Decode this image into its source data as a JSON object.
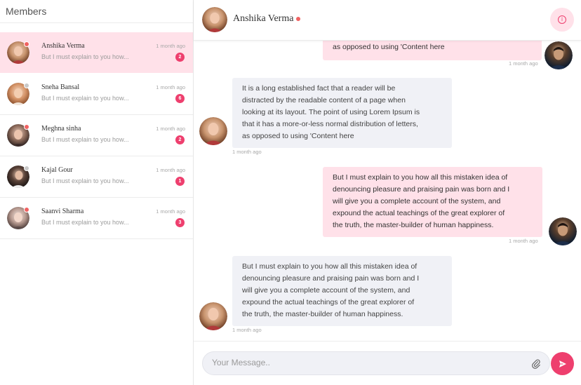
{
  "sidebar": {
    "title": "Members",
    "members": [
      {
        "name": "Anshika Verma",
        "preview": "But I must explain to you how...",
        "time": "1 month ago",
        "unread": "2",
        "online": true
      },
      {
        "name": "Sneha Bansal",
        "preview": "But I must explain to you how...",
        "time": "1 month ago",
        "unread": "6",
        "online": false
      },
      {
        "name": "Meghna sinha",
        "preview": "But I must explain to you how...",
        "time": "1 month ago",
        "unread": "2",
        "online": true
      },
      {
        "name": "Kajal Gour",
        "preview": "But I must explain to you how...",
        "time": "1 month ago",
        "unread": "1",
        "online": false
      },
      {
        "name": "Saanvi Sharma",
        "preview": "But I must explain to you how...",
        "time": "1 month ago",
        "unread": "3",
        "online": true
      }
    ]
  },
  "chat": {
    "contact_name": "Anshika Verma",
    "info_icon": "info-icon",
    "messages": [
      {
        "direction": "out",
        "lines": [
          "as opposed to using 'Content here"
        ],
        "time": "1 month ago"
      },
      {
        "direction": "in",
        "lines": [
          "It is a long established fact that a reader will be",
          "distracted by the readable content of a page when",
          "looking at its layout. The point of using Lorem Ipsum is",
          "that it has a more-or-less normal distribution of letters,",
          "as opposed to using 'Content here"
        ],
        "time": "1 month ago"
      },
      {
        "direction": "out",
        "lines": [
          "But I must explain to you how all this mistaken idea of",
          "denouncing pleasure and praising pain was born and I",
          "will give you a complete account of the system, and",
          "expound the actual teachings of the great explorer of",
          "the truth, the master-builder of human happiness."
        ],
        "time": "1 month ago"
      },
      {
        "direction": "in",
        "lines": [
          "But I must explain to you how all this mistaken idea of",
          "denouncing pleasure and praising pain was born and I",
          "will give you a complete account of the system, and",
          "expound the actual teachings of the great explorer of",
          "the truth, the master-builder of human happiness."
        ],
        "time": "1 month ago"
      }
    ]
  },
  "composer": {
    "placeholder": "Your Message..",
    "value": "",
    "attach_icon": "paperclip-icon",
    "send_icon": "send-icon"
  },
  "colors": {
    "accent": "#ee3f6e",
    "active_bg": "#ffe1e9",
    "incoming_bg": "#f0f1f6",
    "status_online": "#f06262",
    "status_offline": "#c9c9c9"
  }
}
